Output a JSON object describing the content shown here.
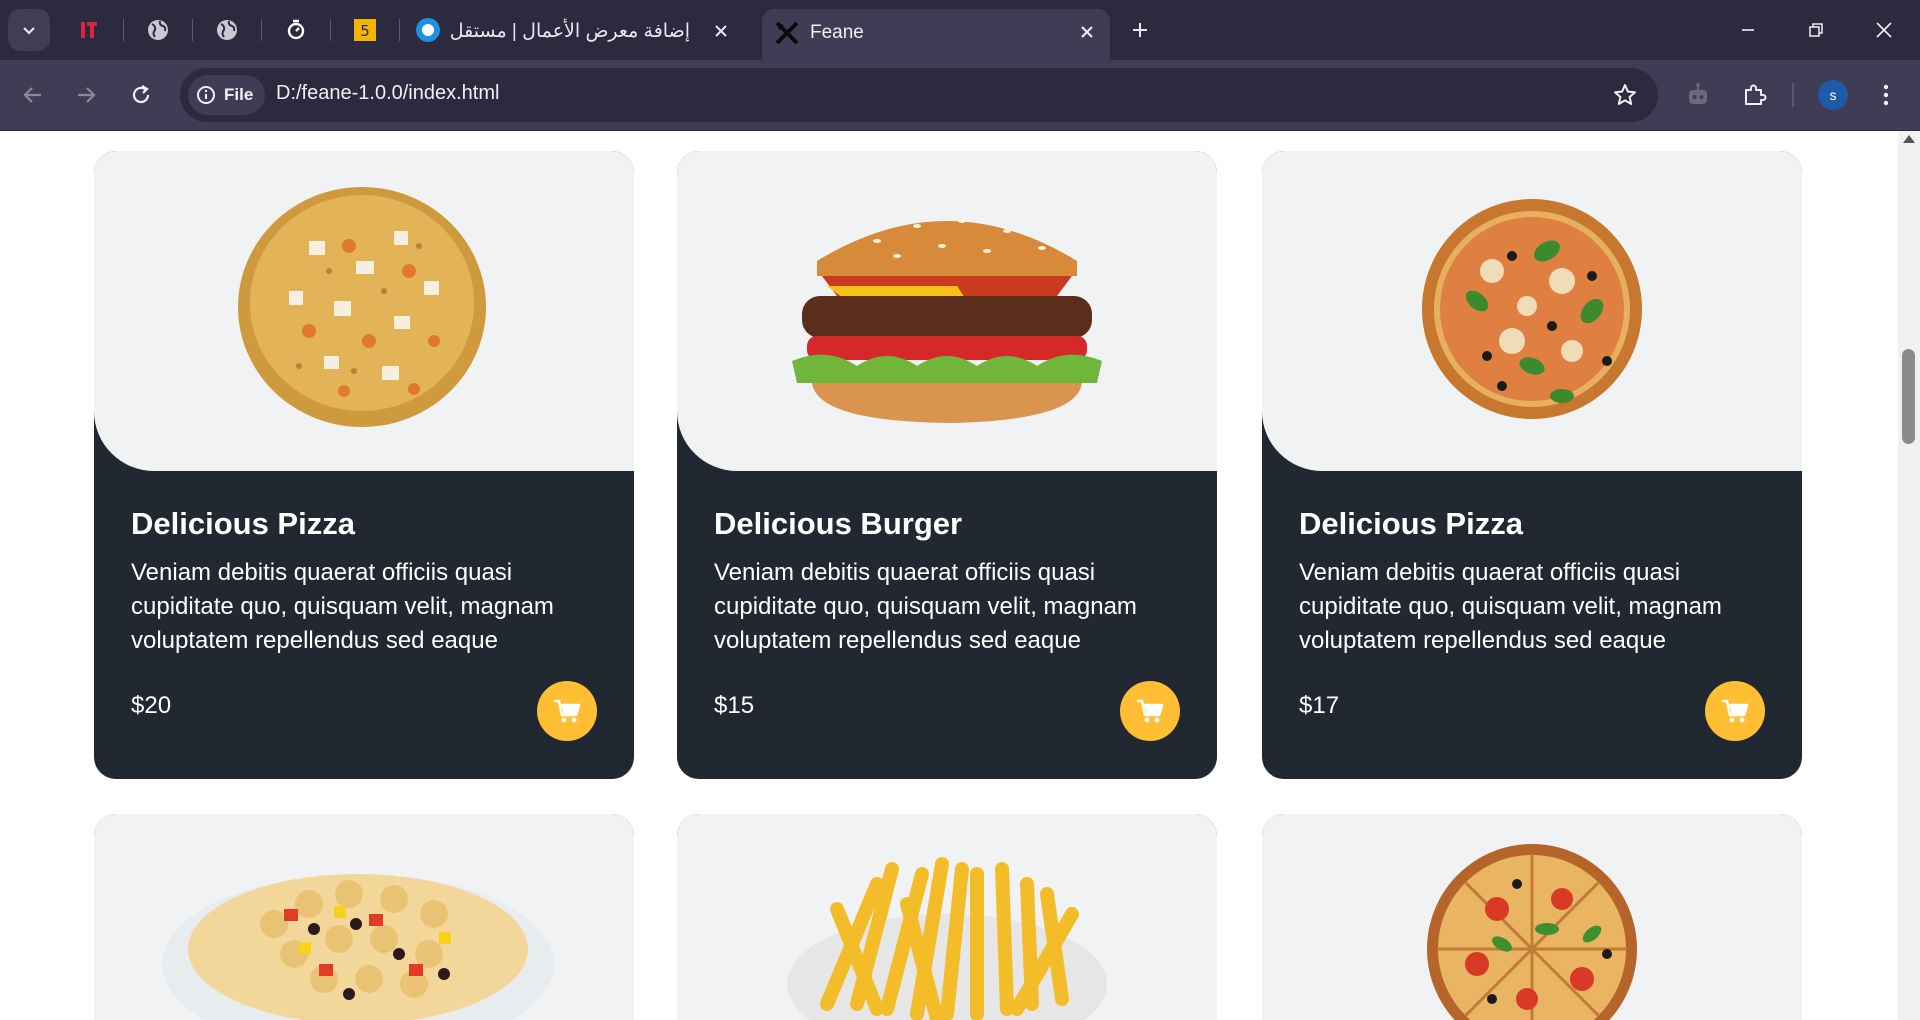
{
  "browser": {
    "tabs": [
      {
        "title": "إضافة معرض الأعمال | مستقل",
        "active": false
      },
      {
        "title": "Feane",
        "active": true
      }
    ],
    "pinned_tab_icons": [
      "khamsat-icon",
      "globe-icon",
      "globe-icon",
      "clock-icon",
      "html5-icon",
      "circle-o-icon"
    ],
    "address": {
      "scheme_label": "File",
      "url": "D:/feane-1.0.0/index.html"
    },
    "profile_initial": "s"
  },
  "colors": {
    "accent": "#ffbe33",
    "card_dark": "#222831",
    "image_bg": "#f1f2f3",
    "chrome_dark": "#2b2a3e",
    "chrome_mid": "#3e3d55"
  },
  "menu": {
    "items": [
      {
        "title": "Delicious Pizza",
        "description": "Veniam debitis quaerat officiis quasi cupiditate quo, quisquam velit, magnam voluptatem repellendus sed eaque",
        "price": "$20",
        "image": "pizza-shrimp"
      },
      {
        "title": "Delicious Burger",
        "description": "Veniam debitis quaerat officiis quasi cupiditate quo, quisquam velit, magnam voluptatem repellendus sed eaque",
        "price": "$15",
        "image": "burger"
      },
      {
        "title": "Delicious Pizza",
        "description": "Veniam debitis quaerat officiis quasi cupiditate quo, quisquam velit, magnam voluptatem repellendus sed eaque",
        "price": "$17",
        "image": "pizza-basil"
      },
      {
        "image": "pasta"
      },
      {
        "image": "fries"
      },
      {
        "image": "pizza-sliced"
      }
    ]
  }
}
